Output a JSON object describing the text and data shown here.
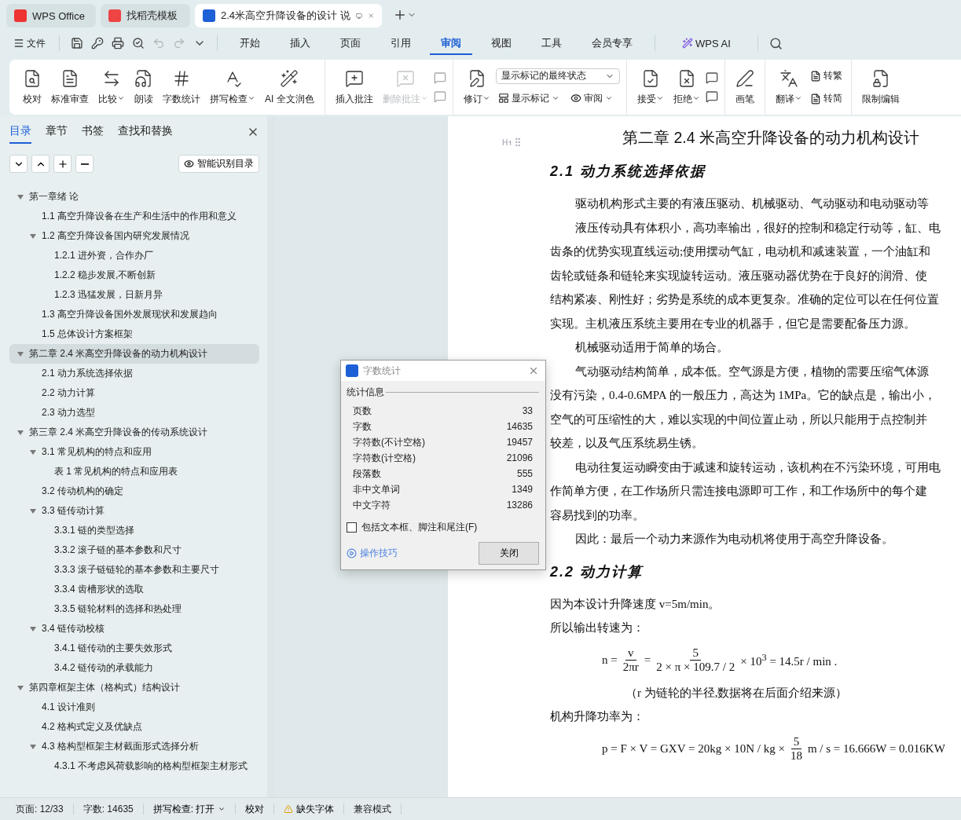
{
  "tabs": [
    {
      "kind": "home",
      "label": "WPS Office",
      "selected": false
    },
    {
      "kind": "template",
      "label": "找稻壳模板",
      "selected": false
    },
    {
      "kind": "doc",
      "label": "2.4米高空升降设备的设计 说",
      "selected": true
    }
  ],
  "menu": {
    "file": "文件",
    "items": [
      {
        "label": "开始",
        "selected": false
      },
      {
        "label": "插入",
        "selected": false
      },
      {
        "label": "页面",
        "selected": false
      },
      {
        "label": "引用",
        "selected": false
      },
      {
        "label": "审阅",
        "selected": true
      },
      {
        "label": "视图",
        "selected": false
      },
      {
        "label": "工具",
        "selected": false
      },
      {
        "label": "会员专享",
        "selected": false
      }
    ],
    "ai": "WPS AI"
  },
  "ribbon": [
    {
      "kind": "large",
      "items": [
        {
          "label": "校对",
          "dropdown": false,
          "disabled": false
        },
        {
          "label": "标准审查",
          "dropdown": false,
          "disabled": false
        },
        {
          "label": "比较",
          "dropdown": true,
          "disabled": false
        },
        {
          "label": "朗读",
          "dropdown": false,
          "disabled": false
        },
        {
          "label": "字数统计",
          "dropdown": false,
          "disabled": false
        },
        {
          "label": "拼写检查",
          "dropdown": true,
          "disabled": false
        },
        {
          "label": "AI 全文润色",
          "dropdown": false,
          "disabled": false
        }
      ]
    },
    {
      "kind": "comments",
      "items": [
        {
          "label": "插入批注",
          "dropdown": false,
          "disabled": false
        },
        {
          "label": "删除批注",
          "dropdown": true,
          "disabled": true
        }
      ]
    },
    {
      "kind": "track",
      "items": [
        {
          "label": "修订",
          "dropdown": true,
          "disabled": false
        }
      ],
      "select": "显示标记的最终状态",
      "small": [
        {
          "label": "显示标记",
          "dropdown": true,
          "disabled": false
        },
        {
          "label": "审阅",
          "dropdown": true,
          "disabled": false
        }
      ]
    },
    {
      "kind": "accept",
      "items": [
        {
          "label": "接受",
          "dropdown": true,
          "disabled": false
        },
        {
          "label": "拒绝",
          "dropdown": true,
          "disabled": false
        }
      ]
    },
    {
      "kind": "large",
      "items": [
        {
          "label": "画笔",
          "dropdown": false,
          "disabled": false
        }
      ]
    },
    {
      "kind": "translate",
      "items": [
        {
          "label": "翻译",
          "dropdown": true,
          "disabled": false
        }
      ],
      "small": [
        {
          "label": "转繁",
          "dropdown": false,
          "disabled": false
        },
        {
          "label": "转简",
          "dropdown": false,
          "disabled": false
        }
      ]
    },
    {
      "kind": "large",
      "items": [
        {
          "label": "限制编辑",
          "dropdown": false,
          "disabled": false
        }
      ]
    }
  ],
  "sidebar": {
    "tabs": [
      {
        "label": "目录",
        "selected": true
      },
      {
        "label": "章节",
        "selected": false
      },
      {
        "label": "书签",
        "selected": false
      },
      {
        "label": "查找和替换",
        "selected": false
      }
    ],
    "smart_button": "智能识别目录",
    "toc": [
      {
        "label": "第一章绪  论",
        "selected": false,
        "expanded": true,
        "children": [
          {
            "label": "1.1  高空升降设备在生产和生活中的作用和意义",
            "selected": false
          },
          {
            "label": "1.2  高空升降设备国内研究发展情况",
            "selected": false,
            "expanded": true,
            "children": [
              {
                "label": "1.2.1  进外资，合作办厂",
                "selected": false
              },
              {
                "label": "1.2.2  稳步发展,不断创新",
                "selected": false
              },
              {
                "label": "1.2.3  迅猛发展，日新月异",
                "selected": false
              }
            ]
          },
          {
            "label": "1.3  高空升降设备国外发展现状和发展趋向",
            "selected": false
          },
          {
            "label": "1.5  总体设计方案框架",
            "selected": false
          }
        ]
      },
      {
        "label": "第二章 2.4 米高空升降设备的动力机构设计",
        "selected": true,
        "expanded": true,
        "children": [
          {
            "label": "2.1  动力系统选择依据",
            "selected": false
          },
          {
            "label": "2.2  动力计算",
            "selected": false
          },
          {
            "label": "2.3  动力选型",
            "selected": false
          }
        ]
      },
      {
        "label": "第三章  2.4 米高空升降设备的传动系统设计",
        "selected": false,
        "expanded": true,
        "children": [
          {
            "label": "3.1 常见机构的特点和应用",
            "selected": false,
            "expanded": true,
            "children": [
              {
                "label": "表 1  常见机构的特点和应用表",
                "selected": false
              }
            ]
          },
          {
            "label": "3.2  传动机构的确定",
            "selected": false
          },
          {
            "label": "3.3  链传动计算",
            "selected": false,
            "expanded": true,
            "children": [
              {
                "label": "3.3.1  链的类型选择",
                "selected": false
              },
              {
                "label": "3.3.2  滚子链的基本参数和尺寸",
                "selected": false
              },
              {
                "label": "3.3.3  滚子链链轮的基本参数和主要尺寸",
                "selected": false
              },
              {
                "label": "3.3.4  齿槽形状的选取",
                "selected": false
              },
              {
                "label": "3.3.5  链轮材料的选择和热处理",
                "selected": false
              }
            ]
          },
          {
            "label": "3.4  链传动校核",
            "selected": false,
            "expanded": true,
            "children": [
              {
                "label": "3.4.1  链传动的主要失效形式",
                "selected": false
              },
              {
                "label": "3.4.2  链传动的承载能力",
                "selected": false
              }
            ]
          }
        ]
      },
      {
        "label": "第四章框架主体（格构式）结构设计",
        "selected": false,
        "expanded": true,
        "children": [
          {
            "label": "4.1  设计准则",
            "selected": false
          },
          {
            "label": "4.2  格构式定义及优缺点",
            "selected": false
          },
          {
            "label": "4.3  格构型框架主材截面形式选择分析",
            "selected": false,
            "expanded": true,
            "children": [
              {
                "label": "4.3.1  不考虑风荷载影响的格构型框架主材形式",
                "selected": false
              }
            ]
          }
        ]
      }
    ]
  },
  "dialog": {
    "title": "字数统计",
    "section": "统计信息",
    "rows": [
      {
        "label": "页数",
        "value": "33"
      },
      {
        "label": "字数",
        "value": "14635"
      },
      {
        "label": "字符数(不计空格)",
        "value": "19457"
      },
      {
        "label": "字符数(计空格)",
        "value": "21096"
      },
      {
        "label": "段落数",
        "value": "555"
      },
      {
        "label": "非中文单词",
        "value": "1349"
      },
      {
        "label": "中文字符",
        "value": "13286"
      }
    ],
    "checkbox": {
      "label": "包括文本框、脚注和尾注(F)",
      "checked": false
    },
    "tips": "操作技巧",
    "close": "关闭"
  },
  "document": {
    "blocks": [
      {
        "kind": "title",
        "text": "第二章 2.4 米高空升降设备的动力机构设计"
      },
      {
        "kind": "heading",
        "text": "2.1  动力系统选择依据"
      },
      {
        "kind": "line",
        "indent": true,
        "text": "驱动机构形式主要的有液压驱动、机械驱动、气动驱动和电动驱动等"
      },
      {
        "kind": "line",
        "indent": true,
        "text": "液压传动具有体积小，高功率输出，很好的控制和稳定行动等，缸、电"
      },
      {
        "kind": "line",
        "indent": false,
        "text": "齿条的优势实现直线运动;使用摆动气缸，电动机和减速装置，一个油缸和"
      },
      {
        "kind": "line",
        "indent": false,
        "text": "齿轮或链条和链轮来实现旋转运动。液压驱动器优势在于良好的润滑、使"
      },
      {
        "kind": "line",
        "indent": false,
        "text": "结构紧凑、刚性好；劣势是系统的成本更复杂。准确的定位可以在任何位置"
      },
      {
        "kind": "line",
        "indent": false,
        "text": "实现。主机液压系统主要用在专业的机器手，但它是需要配备压力源。"
      },
      {
        "kind": "line",
        "indent": true,
        "text": "机械驱动适用于简单的场合。"
      },
      {
        "kind": "line",
        "indent": true,
        "text": "气动驱动结构简单，成本低。空气源是方便，植物的需要压缩气体源"
      },
      {
        "kind": "line",
        "indent": false,
        "text": "没有污染，0.4-0.6MPA 的一般压力，高达为 1MPa。它的缺点是，输出小，"
      },
      {
        "kind": "line",
        "indent": false,
        "text": "空气的可压缩性的大，难以实现的中间位置止动，所以只能用于点控制并"
      },
      {
        "kind": "line",
        "indent": false,
        "text": "较差，以及气压系统易生锈。"
      },
      {
        "kind": "line",
        "indent": true,
        "text": "电动往复运动瞬变由于减速和旋转运动，该机构在不污染环境，可用电"
      },
      {
        "kind": "line",
        "indent": false,
        "text": "作简单方便，在工作场所只需连接电源即可工作，和工作场所中的每个建"
      },
      {
        "kind": "line",
        "indent": false,
        "text": "容易找到的功率。"
      },
      {
        "kind": "line",
        "indent": true,
        "text": "因此：最后一个动力来源作为电动机将使用于高空升降设备。"
      },
      {
        "kind": "heading",
        "text": "2.2  动力计算"
      },
      {
        "kind": "line",
        "indent": false,
        "text": "因为本设计升降速度 v=5m/min。"
      },
      {
        "kind": "line",
        "indent": false,
        "text": "所以输出转速为："
      },
      {
        "kind": "formula",
        "parts": [
          {
            "kind": "text",
            "text": "n ="
          },
          {
            "kind": "frac",
            "num": "v",
            "den": "2πr"
          },
          {
            "kind": "text",
            "text": "="
          },
          {
            "kind": "frac",
            "num": "5",
            "den": "2 × π × 109.7 / 2"
          },
          {
            "kind": "text",
            "text": "× 10$^{3}$ = 14.5r / min  ."
          }
        ]
      },
      {
        "kind": "note",
        "text": "（r 为链轮的半径,数据将在后面介绍来源）"
      },
      {
        "kind": "line",
        "indent": false,
        "text": "机构升降功率为："
      },
      {
        "kind": "formula",
        "parts": [
          {
            "kind": "text",
            "text": "p = F × V = GXV = 20kg × 10N / kg ×"
          },
          {
            "kind": "frac",
            "num": "5",
            "den": "18"
          },
          {
            "kind": "text",
            "text": "m / s = 16.666W = 0.016KW"
          }
        ]
      }
    ]
  },
  "status_bar": [
    {
      "kind": "text",
      "label": "页面: 12/33"
    },
    {
      "kind": "text",
      "label": "字数: 14635"
    },
    {
      "kind": "dropdown",
      "label": "拼写检查: 打开"
    },
    {
      "kind": "button",
      "label": "校对"
    },
    {
      "kind": "warning",
      "label": "缺失字体"
    },
    {
      "kind": "text",
      "label": "兼容模式"
    }
  ]
}
